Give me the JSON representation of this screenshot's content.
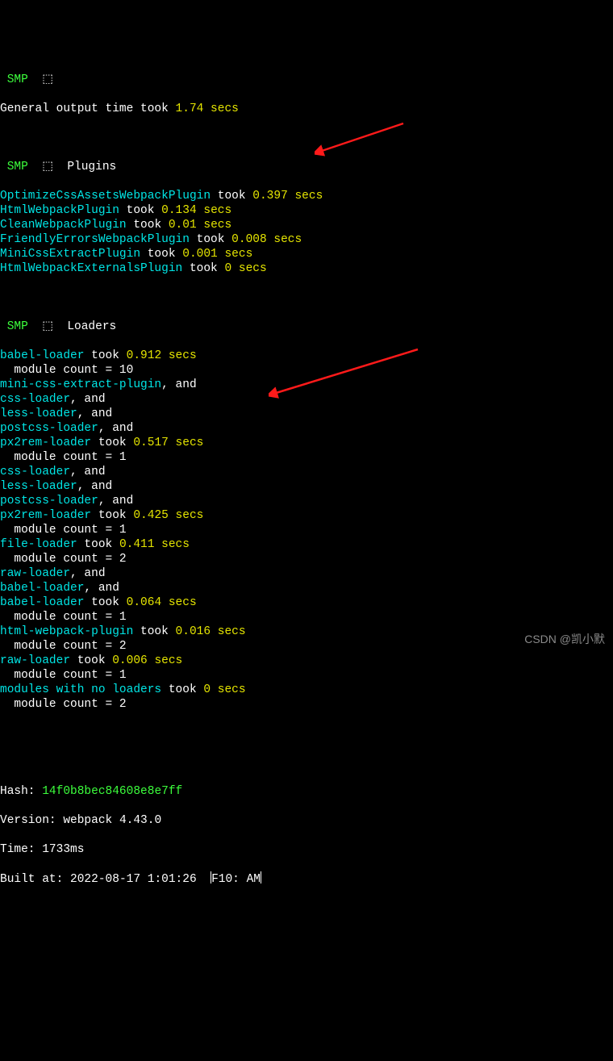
{
  "smp_label": "SMP",
  "box_glyph": "⬚",
  "general_line": {
    "before": "General output time took ",
    "time": "1.74 secs"
  },
  "plugins_header": "Plugins",
  "plugins": [
    {
      "name": "OptimizeCssAssetsWebpackPlugin",
      "took": " took ",
      "time": "0.397 secs"
    },
    {
      "name": "HtmlWebpackPlugin",
      "took": " took ",
      "time": "0.134 secs"
    },
    {
      "name": "CleanWebpackPlugin",
      "took": " took ",
      "time": "0.01 secs"
    },
    {
      "name": "FriendlyErrorsWebpackPlugin",
      "took": " took ",
      "time": "0.008 secs"
    },
    {
      "name": "MiniCssExtractPlugin",
      "took": " took ",
      "time": "0.001 secs"
    },
    {
      "name": "HtmlWebpackExternalsPlugin",
      "took": " took ",
      "time": "0 secs"
    }
  ],
  "loaders_header": "Loaders",
  "loaders": [
    {
      "name": "babel-loader",
      "took": " took ",
      "time": "0.912 secs",
      "module": "module count = 10"
    },
    {
      "name": "mini-css-extract-plugin",
      "suffix": ", and"
    },
    {
      "name": "css-loader",
      "suffix": ", and"
    },
    {
      "name": "less-loader",
      "suffix": ", and"
    },
    {
      "name": "postcss-loader",
      "suffix": ", and"
    },
    {
      "name": "px2rem-loader",
      "took": " took ",
      "time": "0.517 secs",
      "module": "module count = 1"
    },
    {
      "name": "css-loader",
      "suffix": ", and"
    },
    {
      "name": "less-loader",
      "suffix": ", and"
    },
    {
      "name": "postcss-loader",
      "suffix": ", and"
    },
    {
      "name": "px2rem-loader",
      "took": " took ",
      "time": "0.425 secs",
      "module": "module count = 1"
    },
    {
      "name": "file-loader",
      "took": " took ",
      "time": "0.411 secs",
      "module": "module count = 2"
    },
    {
      "name": "raw-loader",
      "suffix": ", and"
    },
    {
      "name": "babel-loader",
      "suffix": ", and"
    },
    {
      "name": "babel-loader",
      "took": " took ",
      "time": "0.064 secs",
      "module": "module count = 1"
    },
    {
      "name": "html-webpack-plugin",
      "took": " took ",
      "time": "0.016 secs",
      "module": "module count = 2"
    },
    {
      "name": "raw-loader",
      "took": " took ",
      "time": "0.006 secs",
      "module": "module count = 1"
    },
    {
      "name": "modules with no loaders",
      "took": " took ",
      "time": "0 secs",
      "module": "module count = 2"
    }
  ],
  "build": {
    "hash_label": "Hash:",
    "hash": "14f0b8bec84608e8e7ff",
    "version_label": "Version:",
    "version": "webpack 4.43.0",
    "time_label": "Time:",
    "time": "1733ms",
    "built_at_label": "Built at:",
    "built_at": "2022-08-17 1:01:26",
    "status_hint": "F10: AM"
  },
  "watermark": "CSDN @凯小默"
}
